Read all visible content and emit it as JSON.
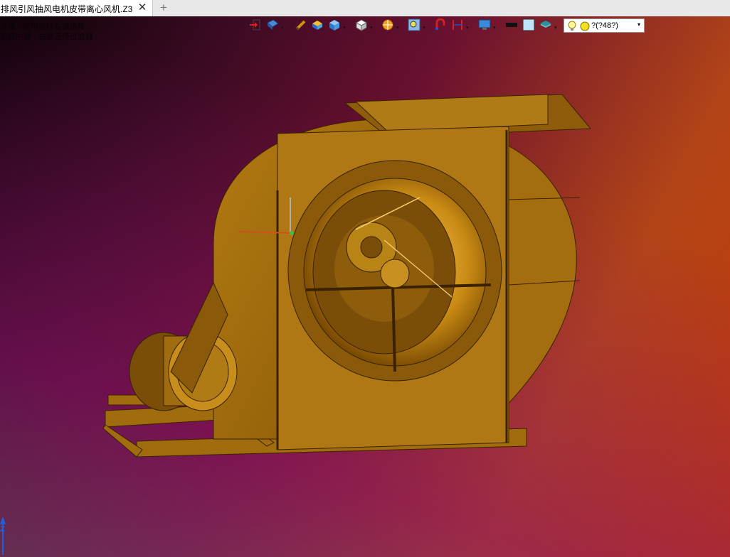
{
  "tab": {
    "title": "排风引风抽风电机皮带离心风机.Z3",
    "close_glyph": "✕",
    "new_glyph": "+"
  },
  "hints": [
    "选择 - 使用鼠标右键选择",
    "鼠标中键 - 右键选择过滤器"
  ],
  "toolbar": {
    "light_value": "?(?48?)",
    "dropdown_glyph": "▾",
    "icons": [
      "exit-icon",
      "view-orient-icon",
      "pen-icon",
      "shaded-box-icon",
      "cube-blue-icon",
      "cube-white-icon",
      "render-style-icon",
      "zoom-icon",
      "magnet-icon",
      "dimension-icon",
      "monitor-icon",
      "black-rect-icon",
      "light-blue-square-icon",
      "layers-icon",
      "bulb-icon"
    ]
  },
  "axis": {
    "z_label": "Z"
  },
  "colors": {
    "model": "#b8860b",
    "tab_bg": "#ffffff",
    "accent": "#1e5fe0"
  }
}
